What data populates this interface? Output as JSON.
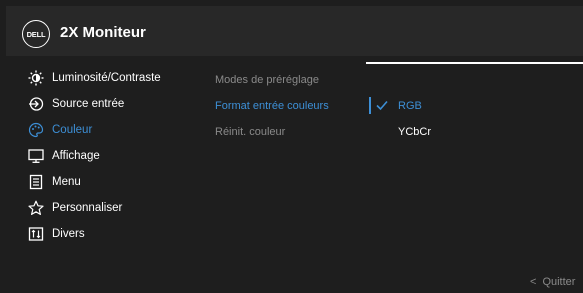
{
  "header": {
    "logo_text": "DELL",
    "title": "2X Moniteur"
  },
  "menu": [
    {
      "label": "Luminosité/Contraste",
      "icon": "brightness-icon"
    },
    {
      "label": "Source entrée",
      "icon": "input-source-icon"
    },
    {
      "label": "Couleur",
      "icon": "color-palette-icon",
      "active": true
    },
    {
      "label": "Affichage",
      "icon": "display-icon"
    },
    {
      "label": "Menu",
      "icon": "menu-list-icon"
    },
    {
      "label": "Personnaliser",
      "icon": "star-icon"
    },
    {
      "label": "Divers",
      "icon": "misc-icon"
    }
  ],
  "submenu": [
    {
      "label": "Modes de préréglage"
    },
    {
      "label": "Format entrée couleurs",
      "active": true
    },
    {
      "label": "Réinit. couleur"
    }
  ],
  "options": {
    "selected": "RGB",
    "items": [
      "RGB",
      "YCbCr"
    ]
  },
  "footer": {
    "exit_label": "Quitter"
  },
  "colors": {
    "accent": "#3d8fd6",
    "text": "#ffffff",
    "muted": "#8a8a8a",
    "background": "#1e1e1e",
    "header_bg": "#282828"
  }
}
